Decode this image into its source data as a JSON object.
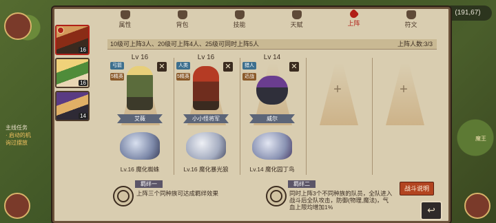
{
  "coords": "(191,67)",
  "tabs": [
    {
      "label": "属性",
      "active": false
    },
    {
      "label": "背包",
      "active": false
    },
    {
      "label": "技能",
      "active": false
    },
    {
      "label": "天赋",
      "active": false
    },
    {
      "label": "上阵",
      "active": true
    },
    {
      "label": "符文",
      "active": false
    }
  ],
  "heroes": [
    {
      "level": "16",
      "selected": true
    },
    {
      "level": "16",
      "selected": false
    },
    {
      "level": "14",
      "selected": false
    }
  ],
  "quest": {
    "title": "主线任务",
    "line1": "· 启动的机",
    "line2": "询过摆放"
  },
  "info": {
    "rule": "10级可上阵3人、20级可上阵4人、25级可同时上阵5人",
    "count": "上阵人数:3/3"
  },
  "slots": [
    {
      "level": "Lv 16",
      "tag1": "弓箭",
      "tag2": "5精英",
      "name": "艾薇",
      "pet": "Lv.16  魔化蜘蛛"
    },
    {
      "level": "Lv 16",
      "tag1": "人类",
      "tag2": "5精英",
      "name": "小小怪将军",
      "pet": "Lv.16  魔化暴光狼"
    },
    {
      "level": "Lv 14",
      "tag1": "猎人",
      "tag2": "近战",
      "name": "威尔",
      "pet": "Lv.14  魔化园丁鸟"
    },
    {
      "empty": true,
      "plus": "+"
    },
    {
      "empty": true,
      "plus": "+"
    }
  ],
  "bonds": [
    {
      "title": "羁绊一",
      "desc": "上阵三个同种族可达成羁绊效果"
    },
    {
      "title": "羁绊二",
      "desc": "同时上阵3个不同种族的队员，全队进入战斗后全队攻击，防御(物理,魔法)，气血上限均增加1%"
    }
  ],
  "battle_btn": "战斗说明",
  "side_label": "魔王"
}
